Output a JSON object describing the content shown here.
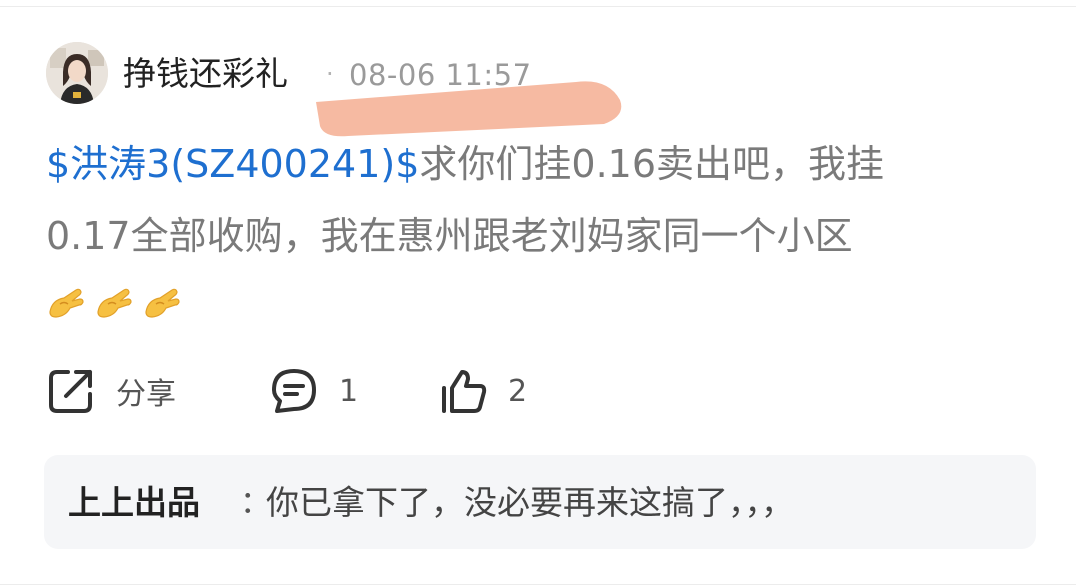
{
  "post": {
    "author": "挣钱还彩礼",
    "separator": "·",
    "time": "08-06 11:57",
    "stock_tag": "$洪涛3(SZ400241)$",
    "body_line1": "求你们挂0.16卖出吧，我挂",
    "body_line2": "0.17全部收购，我在惠州跟老刘妈家同一个小区",
    "emoji": "ok-hand-emoji",
    "emoji_count": 3
  },
  "actions": {
    "share_label": "分享",
    "comment_count": "1",
    "like_count": "2"
  },
  "reply": {
    "author": "上上出品",
    "separator": "：",
    "text": "你已拿下了，没必要再来这搞了，，，"
  },
  "colors": {
    "stock_link": "#1e6fd0",
    "redaction": "#f5b49a",
    "reply_bg": "#f5f6f8"
  }
}
